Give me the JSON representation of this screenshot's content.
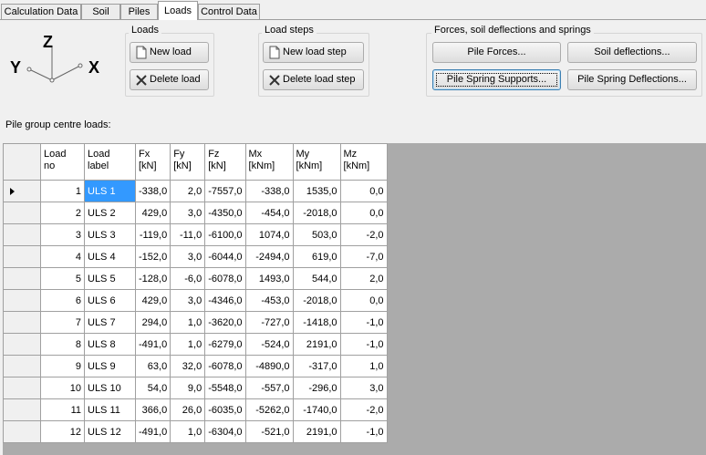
{
  "tabs": [
    {
      "label": "Calculation Data",
      "active": false
    },
    {
      "label": "Soil",
      "active": false
    },
    {
      "label": "Piles",
      "active": false
    },
    {
      "label": "Loads",
      "active": true
    },
    {
      "label": "Control Data",
      "active": false
    }
  ],
  "axes": {
    "z": "Z",
    "y": "Y",
    "x": "X"
  },
  "loads_group": {
    "title": "Loads",
    "new_label": "New load",
    "delete_label": "Delete load",
    "new_icon": "document-icon",
    "delete_icon": "delete-x-icon"
  },
  "load_steps_group": {
    "title": "Load steps",
    "new_label": "New load step",
    "delete_label": "Delete load step"
  },
  "forces_group": {
    "title": "Forces, soil deflections and springs",
    "pile_forces": "Pile Forces...",
    "soil_deflections": "Soil deflections...",
    "pile_spring_supports": "Pile Spring Supports...",
    "pile_spring_deflections": "Pile Spring Deflections..."
  },
  "section_label": "Pile group centre loads:",
  "grid": {
    "columns": [
      {
        "line1": "Load",
        "line2": "no"
      },
      {
        "line1": "Load",
        "line2": "label"
      },
      {
        "line1": "Fx",
        "line2": "[kN]"
      },
      {
        "line1": "Fy",
        "line2": "[kN]"
      },
      {
        "line1": "Fz",
        "line2": "[kN]"
      },
      {
        "line1": "Mx",
        "line2": "[kNm]"
      },
      {
        "line1": "My",
        "line2": "[kNm]"
      },
      {
        "line1": "Mz",
        "line2": "[kNm]"
      }
    ],
    "current_row": 0,
    "rows": [
      [
        "1",
        "ULS 1",
        "-338,0",
        "2,0",
        "-7557,0",
        "-338,0",
        "1535,0",
        "0,0"
      ],
      [
        "2",
        "ULS 2",
        "429,0",
        "3,0",
        "-4350,0",
        "-454,0",
        "-2018,0",
        "0,0"
      ],
      [
        "3",
        "ULS 3",
        "-119,0",
        "-11,0",
        "-6100,0",
        "1074,0",
        "503,0",
        "-2,0"
      ],
      [
        "4",
        "ULS 4",
        "-152,0",
        "3,0",
        "-6044,0",
        "-2494,0",
        "619,0",
        "-7,0"
      ],
      [
        "5",
        "ULS 5",
        "-128,0",
        "-6,0",
        "-6078,0",
        "1493,0",
        "544,0",
        "2,0"
      ],
      [
        "6",
        "ULS 6",
        "429,0",
        "3,0",
        "-4346,0",
        "-453,0",
        "-2018,0",
        "0,0"
      ],
      [
        "7",
        "ULS 7",
        "294,0",
        "1,0",
        "-3620,0",
        "-727,0",
        "-1418,0",
        "-1,0"
      ],
      [
        "8",
        "ULS 8",
        "-491,0",
        "1,0",
        "-6279,0",
        "-524,0",
        "2191,0",
        "-1,0"
      ],
      [
        "9",
        "ULS 9",
        "63,0",
        "32,0",
        "-6078,0",
        "-4890,0",
        "-317,0",
        "1,0"
      ],
      [
        "10",
        "ULS 10",
        "54,0",
        "9,0",
        "-5548,0",
        "-557,0",
        "-296,0",
        "3,0"
      ],
      [
        "11",
        "ULS 11",
        "366,0",
        "26,0",
        "-6035,0",
        "-5262,0",
        "-1740,0",
        "-2,0"
      ],
      [
        "12",
        "ULS 12",
        "-491,0",
        "1,0",
        "-6304,0",
        "-521,0",
        "2191,0",
        "-1,0"
      ]
    ]
  }
}
